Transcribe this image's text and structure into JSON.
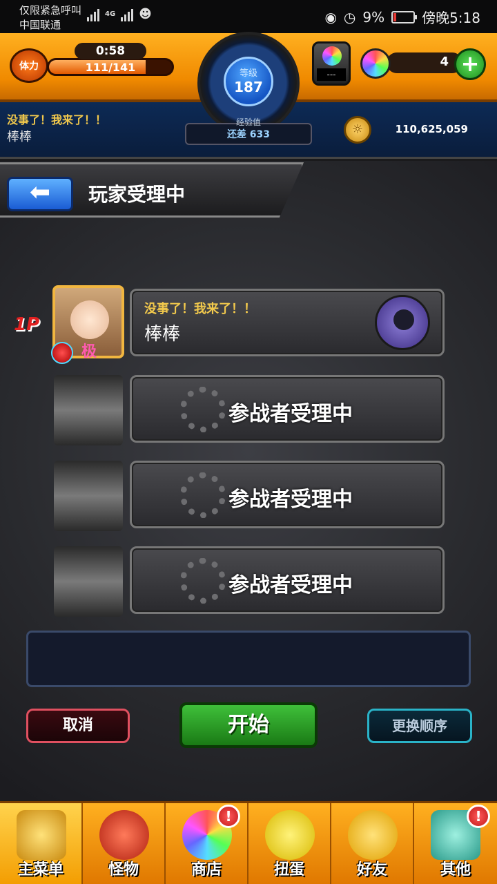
{
  "status_bar": {
    "carrier_line1": "仅限紧急呼叫",
    "carrier_line2": "中国联通",
    "network": "4G",
    "battery": "9%",
    "time": "傍晚5:18"
  },
  "hud": {
    "stamina_label": "体力",
    "stamina_timer": "0:58",
    "stamina_value": "111/141",
    "stamina_fraction": 0.787,
    "level_label": "等级",
    "level_value": "187",
    "exp_label": "经验值",
    "exp_remaining": "还差 633",
    "gem_machine_text": "---",
    "gem_count": "4",
    "add_label": "+",
    "coin_amount": "110,625,059",
    "player_message": "没事了！我来了！！",
    "player_name": "棒棒"
  },
  "lobby": {
    "title": "玩家受理中",
    "back_icon": "back-arrow-icon",
    "slot_label_1p": "1P",
    "avatar_grade": "极",
    "slot1": {
      "message": "没事了！我来了！！",
      "name": "棒棒"
    },
    "waiting_text": "参战者受理中",
    "buttons": {
      "cancel": "取消",
      "start": "开始",
      "reorder": "更换顺序"
    }
  },
  "bottom_nav": [
    {
      "label": "主菜单",
      "icon": "main-menu-icon",
      "badge": ""
    },
    {
      "label": "怪物",
      "icon": "monster-icon",
      "badge": ""
    },
    {
      "label": "商店",
      "icon": "shop-icon",
      "badge": "!"
    },
    {
      "label": "扭蛋",
      "icon": "gacha-icon",
      "badge": ""
    },
    {
      "label": "好友",
      "icon": "friends-icon",
      "badge": ""
    },
    {
      "label": "其他",
      "icon": "other-icon",
      "badge": "!"
    }
  ],
  "colors": {
    "hud_orange": "#f08a00",
    "start_green": "#1a7a15",
    "cancel_red": "#e05060",
    "reorder_cyan": "#2ab3c8",
    "message_yellow": "#f2c94c"
  }
}
